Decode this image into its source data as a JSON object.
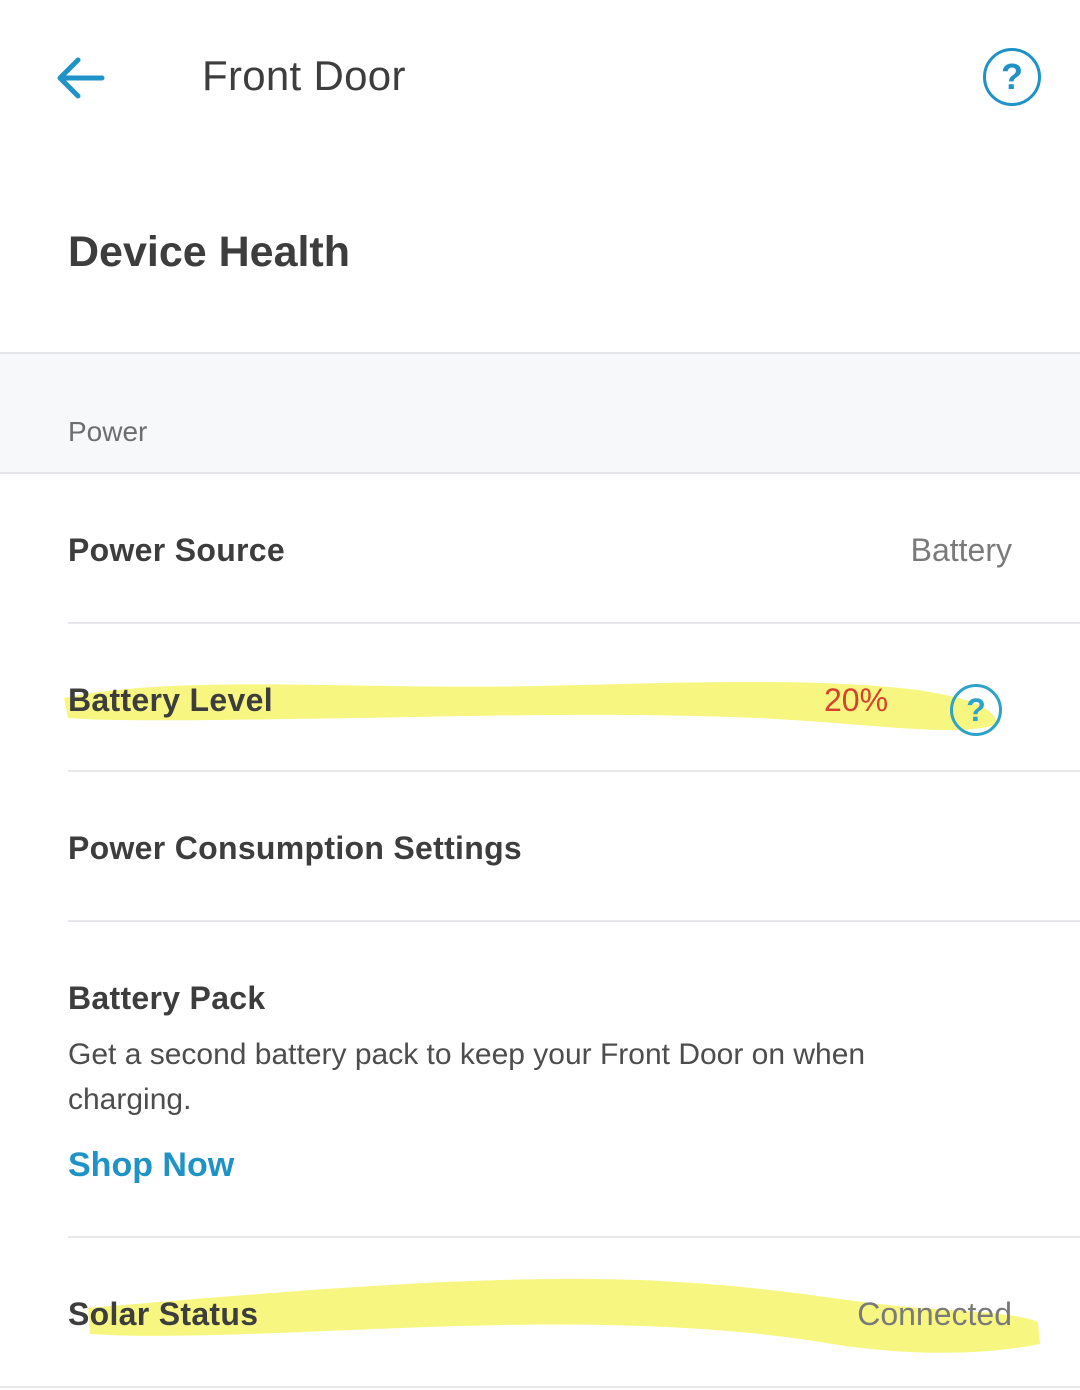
{
  "header": {
    "back_icon": "arrow-left-icon",
    "title": "Front Door",
    "help_icon": "question-circle-icon",
    "help_symbol": "?"
  },
  "page": {
    "heading": "Device Health"
  },
  "section": {
    "label": "Power"
  },
  "rows": {
    "power_source": {
      "label": "Power Source",
      "value": "Battery"
    },
    "battery_level": {
      "label": "Battery Level",
      "value": "20%",
      "help_symbol": "?"
    },
    "power_consumption": {
      "label": "Power Consumption Settings"
    },
    "battery_pack": {
      "label": "Battery Pack",
      "description": "Get a second battery pack to keep your Front Door on when charging.",
      "link": "Shop Now"
    },
    "solar_status": {
      "label": "Solar Status",
      "value": "Connected"
    }
  },
  "colors": {
    "accent": "#1f93c7",
    "warning": "#d4422e",
    "highlight": "#f6f56a"
  }
}
